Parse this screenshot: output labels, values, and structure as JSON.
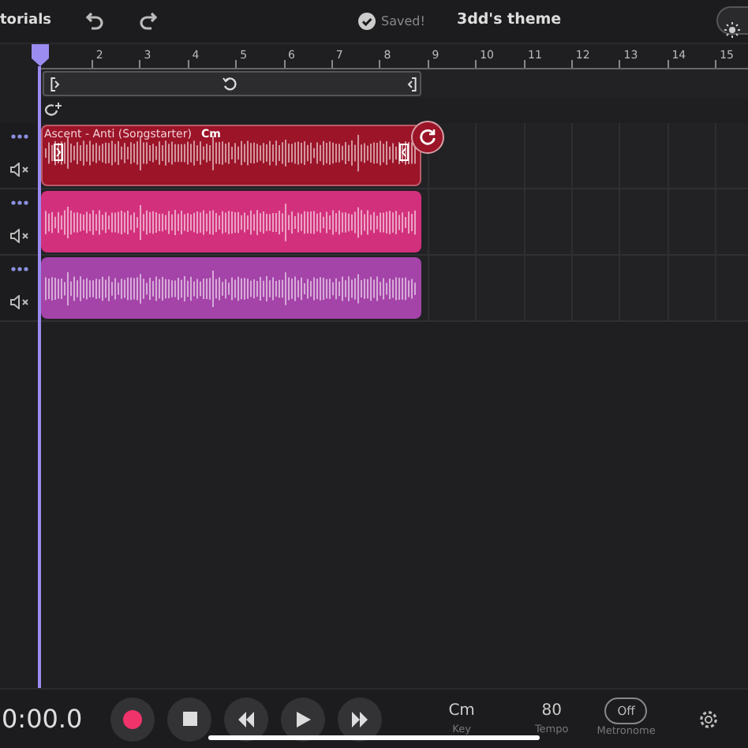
{
  "top_bar": {
    "tutorials_link": "torials",
    "saved_status": "Saved!",
    "project_title": "3dd's theme",
    "theme_toggle": {
      "on": false
    }
  },
  "ruler": {
    "marks": [
      "2",
      "3",
      "4",
      "5",
      "6",
      "7",
      "8",
      "9",
      "10",
      "11",
      "12",
      "13",
      "14",
      "15"
    ]
  },
  "tracks": [
    {
      "clip": {
        "title": "Ascent - Anti (Songstarter)",
        "key": "Cm",
        "color": "#9b1428",
        "selected": true
      }
    },
    {
      "clip": {
        "color": "#d2307c",
        "selected": false
      }
    },
    {
      "clip": {
        "color": "#a443a8",
        "selected": false
      }
    }
  ],
  "transport": {
    "time": "0:00.0",
    "key": "Cm",
    "key_label": "Key",
    "tempo": "80",
    "tempo_label": "Tempo",
    "metronome": "Off",
    "metronome_label": "Metronome"
  }
}
